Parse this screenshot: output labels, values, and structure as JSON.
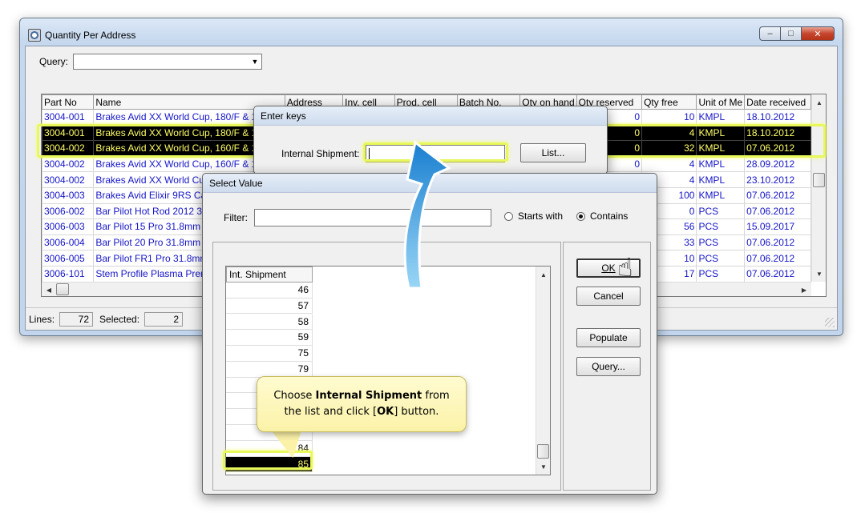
{
  "main_window": {
    "title": "Quantity Per Address",
    "query_label": "Query:",
    "query_value": "",
    "columns": [
      "Part No",
      "Name",
      "Address",
      "Inv. cell",
      "Prod. cell",
      "Batch No.",
      "Qty on hand",
      "Qty reserved",
      "Qty free",
      "Unit of Me",
      "Date received"
    ],
    "rows": [
      {
        "part": "3004-001",
        "name": "Brakes Avid XX World Cup, 180/F & 1",
        "reserved": "0",
        "free": "10",
        "unit": "KMPL",
        "date": "18.10.2012",
        "selected": false
      },
      {
        "part": "3004-001",
        "name": "Brakes Avid XX World Cup, 180/F & 1",
        "reserved": "0",
        "free": "4",
        "unit": "KMPL",
        "date": "18.10.2012",
        "selected": true
      },
      {
        "part": "3004-002",
        "name": "Brakes Avid XX World Cup, 160/F & 1",
        "reserved": "0",
        "free": "32",
        "unit": "KMPL",
        "date": "07.06.2012",
        "selected": true
      },
      {
        "part": "3004-002",
        "name": "Brakes Avid XX World Cup, 160/F & 1",
        "reserved": "0",
        "free": "4",
        "unit": "KMPL",
        "date": "28.09.2012",
        "selected": false
      },
      {
        "part": "3004-002",
        "name": "Brakes Avid XX World Cu",
        "reserved": "",
        "free": "4",
        "unit": "KMPL",
        "date": "23.10.2012",
        "selected": false
      },
      {
        "part": "3004-003",
        "name": "Brakes Avid Elixir 9RS Ca",
        "reserved": "",
        "free": "100",
        "unit": "KMPL",
        "date": "07.06.2012",
        "selected": false
      },
      {
        "part": "3006-002",
        "name": "Bar Pilot Hot Rod 2012 31",
        "reserved": "",
        "free": "0",
        "unit": "PCS",
        "date": "07.06.2012",
        "selected": false
      },
      {
        "part": "3006-003",
        "name": "Bar Pilot 15 Pro 31.8mm 6",
        "reserved": "",
        "free": "56",
        "unit": "PCS",
        "date": "15.09.2017",
        "selected": false
      },
      {
        "part": "3006-004",
        "name": "Bar Pilot 20 Pro 31.8mm 7",
        "reserved": "",
        "free": "33",
        "unit": "PCS",
        "date": "07.06.2012",
        "selected": false
      },
      {
        "part": "3006-005",
        "name": "Bar Pilot FR1 Pro 31.8mm",
        "reserved": "",
        "free": "10",
        "unit": "PCS",
        "date": "07.06.2012",
        "selected": false
      },
      {
        "part": "3006-101",
        "name": "Stem Profile Plasma Premi",
        "reserved": "",
        "free": "17",
        "unit": "PCS",
        "date": "07.06.2012",
        "selected": false
      }
    ],
    "status": {
      "lines_label": "Lines:",
      "lines_value": "72",
      "selected_label": "Selected:",
      "selected_value": "2"
    }
  },
  "enter_keys": {
    "title": "Enter keys",
    "field_label": "Internal Shipment:",
    "field_value": "",
    "list_button": "List..."
  },
  "select_value": {
    "title": "Select Value",
    "filter_label": "Filter:",
    "filter_value": "",
    "radio_starts": "Starts with",
    "radio_contains": "Contains",
    "contains_selected": true,
    "column_header": "Int. Shipment",
    "values": [
      "46",
      "57",
      "58",
      "59",
      "75",
      "79",
      "",
      "",
      "",
      "",
      "84",
      "85"
    ],
    "selected_value": "85",
    "ok_button": "OK",
    "cancel_button": "Cancel",
    "populate_button": "Populate",
    "query_button": "Query..."
  },
  "callout": {
    "text_before": "Choose ",
    "text_bold1": "Internal Shipment",
    "text_middle": " from the list and click [",
    "text_bold2": "OK",
    "text_after": "] button."
  },
  "colors": {
    "highlight": "#e8f85a",
    "selected_row_bg": "#000000",
    "selected_row_text": "#ffff66",
    "link_text": "#1515c8",
    "arrow": "#3aa6e6"
  }
}
